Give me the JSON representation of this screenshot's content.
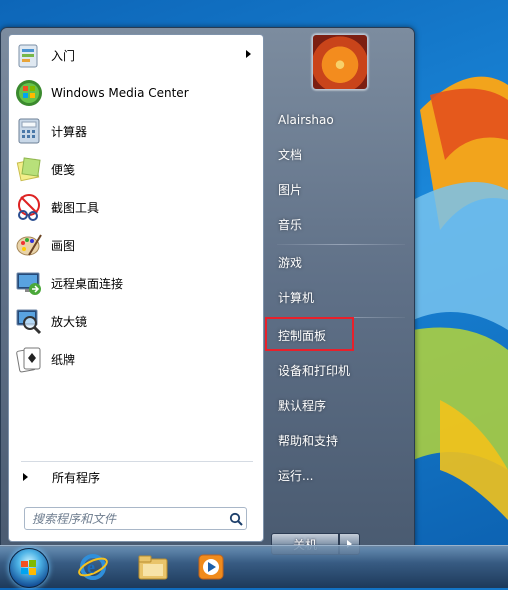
{
  "left_pane": {
    "programs": [
      {
        "label": "入门",
        "icon": "getting-started-icon",
        "submenu": true
      },
      {
        "label": "Windows Media Center",
        "icon": "media-center-icon"
      },
      {
        "label": "计算器",
        "icon": "calculator-icon"
      },
      {
        "label": "便笺",
        "icon": "sticky-notes-icon"
      },
      {
        "label": "截图工具",
        "icon": "snipping-tool-icon"
      },
      {
        "label": "画图",
        "icon": "paint-icon"
      },
      {
        "label": "远程桌面连接",
        "icon": "remote-desktop-icon"
      },
      {
        "label": "放大镜",
        "icon": "magnifier-icon"
      },
      {
        "label": "纸牌",
        "icon": "solitaire-icon"
      }
    ],
    "all_programs": "所有程序",
    "search_placeholder": "搜索程序和文件"
  },
  "right_pane": {
    "user_name": "Alairshao",
    "items": [
      "文档",
      "图片",
      "音乐",
      "游戏",
      "计算机",
      "控制面板",
      "设备和打印机",
      "默认程序",
      "帮助和支持",
      "运行..."
    ],
    "highlighted": "控制面板",
    "shutdown_label": "关机"
  },
  "taskbar": {
    "items": [
      "internet-explorer-icon",
      "file-explorer-icon",
      "media-player-icon"
    ]
  },
  "colors": {
    "highlight_border": "#e8202b"
  }
}
